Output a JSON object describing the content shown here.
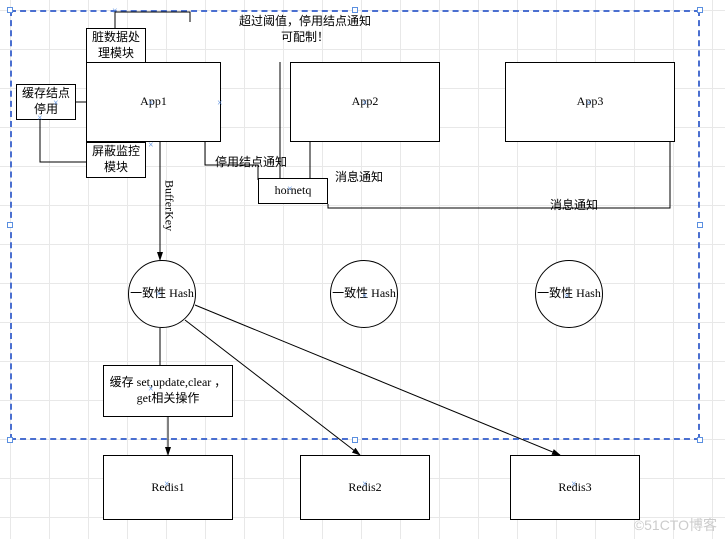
{
  "notes": {
    "top": "超过阈值，停用结点通知\n可配制！",
    "disable_notify": "停用结点通知",
    "msg_notify_1": "消息通知",
    "msg_notify_2": "消息通知"
  },
  "modules": {
    "dirty_data": "脏数据处\n理模块",
    "cache_disable": "缓存结点\n停用",
    "shield_monitor": "屏蔽监控\n模块",
    "cache_ops": "缓存\nset,update,clear\n，get相关操作"
  },
  "apps": {
    "app1": "App1",
    "app2": "App2",
    "app3": "App3"
  },
  "mq": "hornetq",
  "arrow_label": "BufferKey",
  "hashes": {
    "h1": "一致性\nHash",
    "h2": "一致性\nHash",
    "h3": "一致性\nHash"
  },
  "redis": {
    "r1": "Redis1",
    "r2": "Redis2",
    "r3": "Redis3"
  },
  "watermark": "©51CTO博客"
}
